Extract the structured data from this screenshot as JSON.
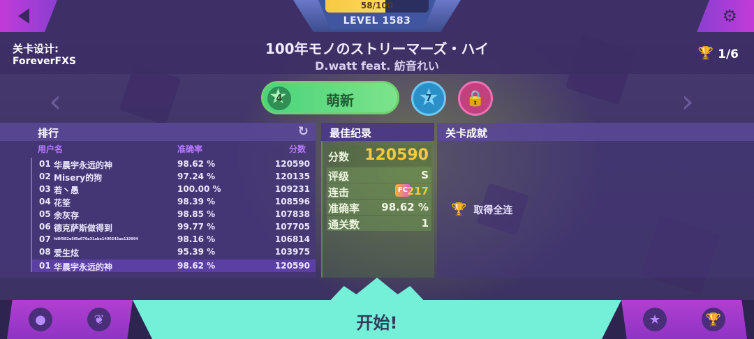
{
  "level": {
    "xp_text": "58/100",
    "xp_progress": 0.58,
    "label": "LEVEL 1583"
  },
  "designer": {
    "label": "关卡设计:",
    "name": "ForeverFXS"
  },
  "song": {
    "title": "100年モノのストリーマーズ・ハイ",
    "artist": "D.watt feat. 紡音れい"
  },
  "trophies": {
    "count": "1/6",
    "icon": "trophy-icon"
  },
  "difficulty": {
    "current": {
      "level": "4",
      "label": "萌新"
    },
    "next": {
      "level": "7"
    },
    "locked": {
      "icon": "lock-icon"
    }
  },
  "leaderboard": {
    "title": "排行",
    "columns": {
      "user": "用户名",
      "accuracy": "准确率",
      "score": "分数"
    },
    "rows": [
      {
        "pos": "01",
        "name": "华晨宇永远的神",
        "acc": "98.62 %",
        "score": "120590"
      },
      {
        "pos": "02",
        "name": "Misery的狗",
        "acc": "97.24 %",
        "score": "120135"
      },
      {
        "pos": "03",
        "name": "若丶愚",
        "acc": "100.00 %",
        "score": "109231"
      },
      {
        "pos": "04",
        "name": "花筌",
        "acc": "98.39 %",
        "score": "108596"
      },
      {
        "pos": "05",
        "name": "余灰存",
        "acc": "98.85 %",
        "score": "107838"
      },
      {
        "pos": "06",
        "name": "德克萨斯做得到",
        "acc": "99.77 %",
        "score": "107705"
      },
      {
        "pos": "07",
        "name": "fd8f982e6f8a676a31abe1400242ae119994",
        "acc": "98.16 %",
        "score": "106814"
      },
      {
        "pos": "08",
        "name": "爱生炫",
        "acc": "95.39 %",
        "score": "103975"
      }
    ],
    "me": {
      "pos": "01",
      "name": "华晨宇永远的神",
      "acc": "98.62 %",
      "score": "120590"
    }
  },
  "best": {
    "title": "最佳纪录",
    "score_label": "分数",
    "score": "120590",
    "grade_label": "评级",
    "grade": "S",
    "combo_label": "连击",
    "combo_badge": "FC",
    "combo": "217",
    "accuracy_label": "准确率",
    "accuracy": "98.62 %",
    "clears_label": "通关数",
    "clears": "1"
  },
  "achievements": {
    "title": "关卡成就",
    "items": [
      {
        "label": "取得全连",
        "icon": "trophy-icon"
      }
    ]
  },
  "start": {
    "label": "开始!"
  },
  "colors": {
    "accent_cyan": "#74f0d9",
    "gold": "#f6c93e",
    "purple": "#b979ff",
    "green": "#4ad47a"
  }
}
